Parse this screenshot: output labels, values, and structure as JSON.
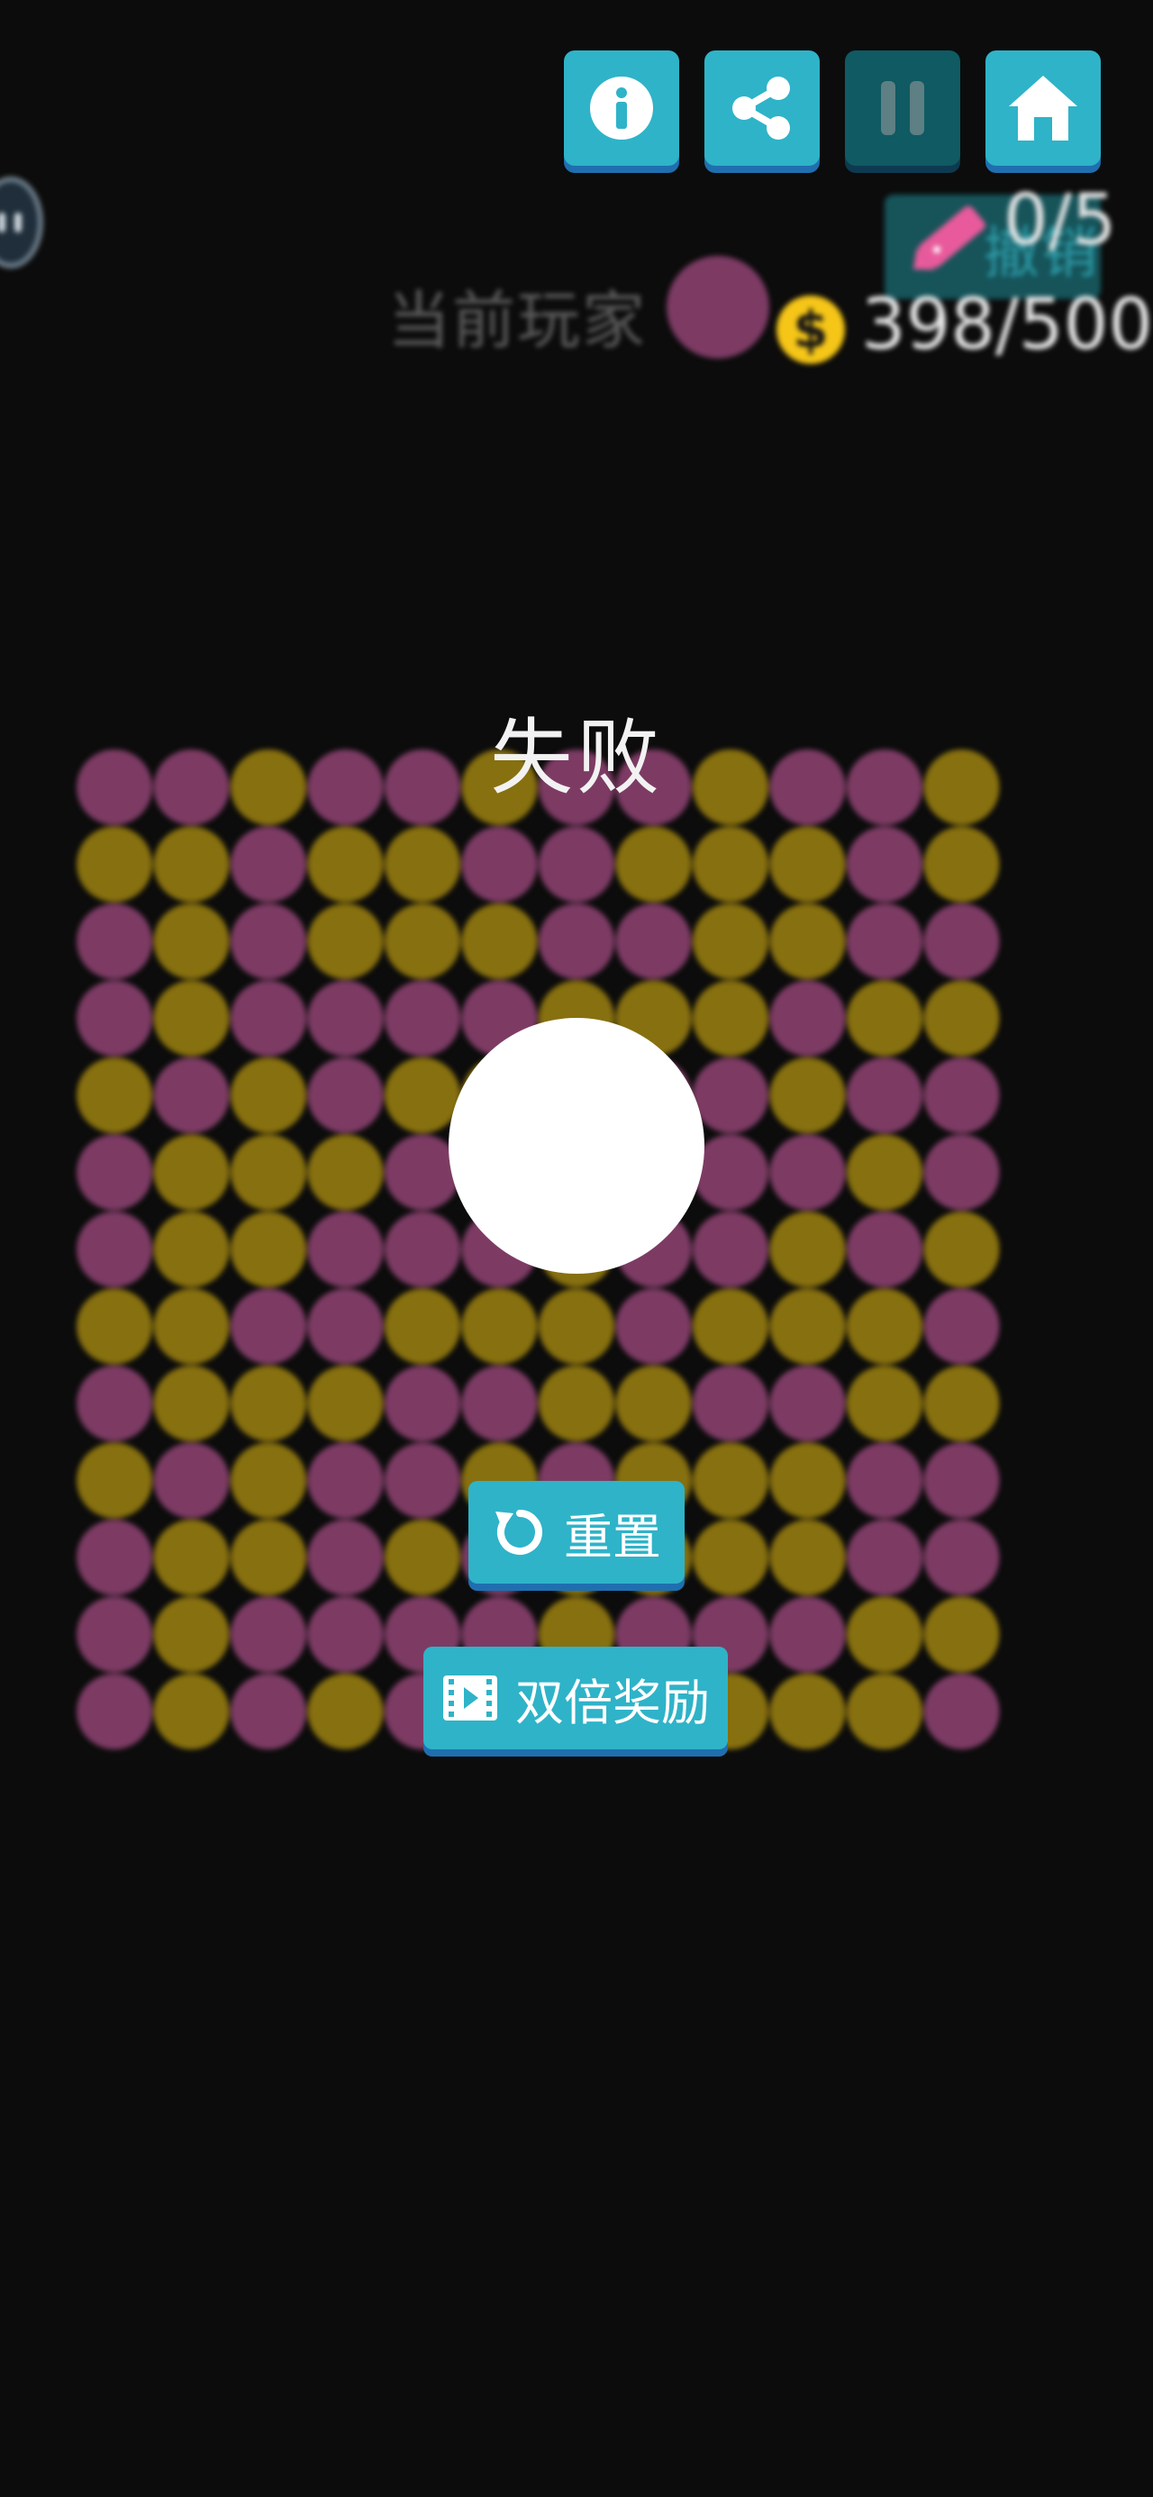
{
  "colors": {
    "magenta": "#7d3b64",
    "olive": "#87700f",
    "accent": "#2fb3c8",
    "coin": "#f5c518"
  },
  "toolbar": {
    "buttons": [
      {
        "name": "info",
        "icon": "info-icon"
      },
      {
        "name": "share",
        "icon": "share-icon"
      },
      {
        "name": "pause",
        "icon": "pause-icon"
      },
      {
        "name": "home",
        "icon": "home-icon"
      }
    ]
  },
  "hud": {
    "undo_label": "撤销",
    "undo_count": "0/5",
    "current_player_label": "当前玩家",
    "current_player_color": "#7d3b64",
    "coins": "398/500"
  },
  "board": {
    "rows": [
      "MMOMMOMMOMMO",
      "OOMOOMMOOOMO",
      "MOMOOOMMOOMM",
      "MOMMMMOOOMOO",
      "OMOMOOMMMOMM",
      "MOOOMMOMMMOM",
      "MOOMMMOMMOMO",
      "OOMMOOOMOOOM",
      "MOOOMMOOMMOO",
      "OMOMMOMOOOMM",
      "MOOMOMOOOOMM",
      "MOMMMMOMMMOO",
      "MOMOMOOMOOOM"
    ]
  },
  "overlay": {
    "title": "失败",
    "reset_label": "重置",
    "reward_label": "双倍奖励"
  }
}
